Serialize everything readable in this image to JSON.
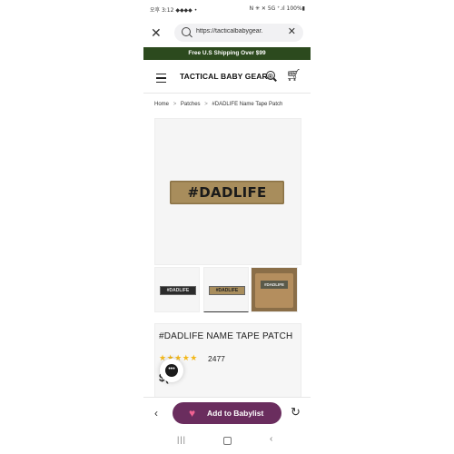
{
  "status_bar": {
    "left": "오후 3:12 ◆◆◆◆ •",
    "right": "N ✳ ✕ 5G ⁺.ıl 100%▮"
  },
  "browser": {
    "url": "https://tacticalbabygear.",
    "close_icon": "close-icon",
    "clear_icon": "close-icon"
  },
  "promo_banner": {
    "text": "Free U.S Shipping Over $99"
  },
  "header": {
    "brand": "TACTICAL BABY GEAR®",
    "icons": [
      "menu-icon",
      "search-icon",
      "cart-icon"
    ]
  },
  "breadcrumb": {
    "items": [
      "Home",
      "Patches",
      "#DADLIFE Name Tape Patch"
    ],
    "separator": ">"
  },
  "product_image": {
    "patch_text": "#DADLIFE"
  },
  "thumbnails": [
    {
      "patch_text": "#DADLIFE"
    },
    {
      "patch_text": "#DADLIFE"
    },
    {
      "patch_text": "#DADLIFE"
    }
  ],
  "product": {
    "title": "#DADLIFE NAME TAPE PATCH",
    "rating_stars": "★★★★★",
    "review_count": "2477",
    "price_fragment": "$("
  },
  "chat": {
    "icon": "chat-icon",
    "glyph": "•••"
  },
  "bottom_bar": {
    "back_glyph": "‹",
    "babylist_label": "Add to Babylist",
    "heart_glyph": "♥",
    "reload_glyph": "↻"
  },
  "system_nav": {
    "recent": "|||",
    "back": "‹"
  },
  "colors": {
    "promo_bg": "#2c4a1e",
    "babylist_button": "#6a2d5e",
    "heart": "#f06292",
    "stars": "#f3b81b",
    "patch": "#a88d5c"
  }
}
